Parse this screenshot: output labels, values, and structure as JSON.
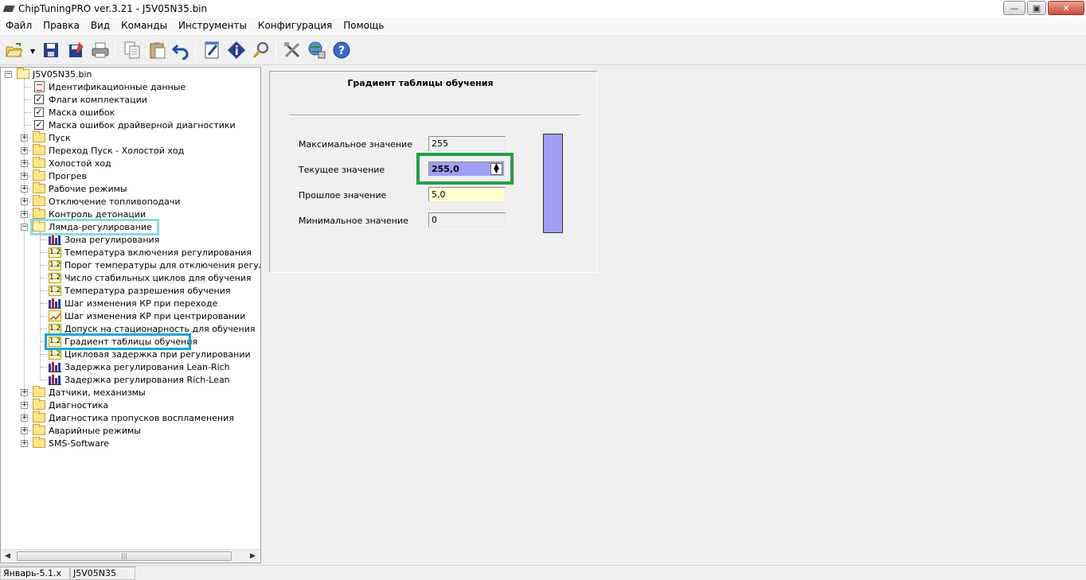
{
  "window": {
    "title": "ChipTuningPRO ver.3.21 - J5V05N35.bin",
    "controls": [
      "minimize",
      "maximize",
      "close"
    ]
  },
  "menu": [
    "Файл",
    "Правка",
    "Вид",
    "Команды",
    "Инструменты",
    "Конфигурация",
    "Помощь"
  ],
  "toolbar": [
    "open-icon",
    "save-icon",
    "save-as-icon",
    "print-icon",
    "copy-icon",
    "paste-icon",
    "undo-icon",
    "edit-icon",
    "info-icon",
    "search-icon",
    "tools-icon",
    "network-icon",
    "help-icon"
  ],
  "tree": {
    "root": "J5V05N35.bin",
    "items": [
      {
        "label": "Идентификационные данные",
        "icon": "document-icon"
      },
      {
        "label": "Флаги комплектации",
        "icon": "checkbox-icon"
      },
      {
        "label": "Маска ошибок",
        "icon": "checkbox-icon"
      },
      {
        "label": "Маска ошибок драйверной диагностики",
        "icon": "checkbox-icon"
      },
      {
        "label": "Пуск",
        "icon": "folder-icon"
      },
      {
        "label": "Переход Пуск - Холостой ход",
        "icon": "folder-icon"
      },
      {
        "label": "Холостой ход",
        "icon": "folder-icon"
      },
      {
        "label": "Прогрев",
        "icon": "folder-icon"
      },
      {
        "label": "Рабочие режимы",
        "icon": "folder-icon"
      },
      {
        "label": "Отключение топливоподачи",
        "icon": "folder-icon"
      },
      {
        "label": "Контроль детонации",
        "icon": "folder-icon"
      },
      {
        "label": "Лямда-регулирование",
        "icon": "open-folder-icon",
        "expanded": true
      },
      {
        "label": "Зона регулирования",
        "icon": "bar-chart-icon"
      },
      {
        "label": "Температура включения регулирования",
        "icon": "number-icon",
        "icon_text": "1.2"
      },
      {
        "label": "Порог температуры для отключения регулирования",
        "icon": "number-icon",
        "icon_text": "1.2"
      },
      {
        "label": "Число стабильных циклов для обучения",
        "icon": "number-icon",
        "icon_text": "1.2"
      },
      {
        "label": "Температура разрешения обучения",
        "icon": "number-icon",
        "icon_text": "1.2"
      },
      {
        "label": "Шаг изменения КР при переходе",
        "icon": "bar-chart-icon"
      },
      {
        "label": "Шаг изменения КР при центрировании",
        "icon": "graph-icon"
      },
      {
        "label": "Допуск на стационарность для обучения",
        "icon": "number-icon",
        "icon_text": "1.2"
      },
      {
        "label": "Градиент таблицы обучения",
        "icon": "number-icon",
        "icon_text": "1.2",
        "selected": true
      },
      {
        "label": "Цикловая задержка при регулировании",
        "icon": "number-icon",
        "icon_text": "1.2"
      },
      {
        "label": "Задержка регулирования Lean-Rich",
        "icon": "bar-chart-icon"
      },
      {
        "label": "Задержка регулирования Rich-Lean",
        "icon": "bar-chart-icon"
      },
      {
        "label": "Датчики, механизмы",
        "icon": "folder-icon"
      },
      {
        "label": "Диагностика",
        "icon": "folder-icon"
      },
      {
        "label": "Диагностика пропусков воспламенения",
        "icon": "folder-icon"
      },
      {
        "label": "Аварийные режимы",
        "icon": "folder-icon"
      },
      {
        "label": "SMS-Software",
        "icon": "folder-icon"
      }
    ]
  },
  "panel": {
    "title": "Градиент таблицы обучения",
    "max_label": "Максимальное значение",
    "max_value": "255",
    "current_label": "Текущее значение",
    "current_value": "255,0",
    "previous_label": "Прошлое значение",
    "previous_value": "5,0",
    "min_label": "Минимальное значение",
    "min_value": "0",
    "gauge_level": 1.0,
    "accent_color": "#9f9ff6"
  },
  "status": {
    "left": "Январь-5.1.x",
    "right": "J5V05N35"
  }
}
